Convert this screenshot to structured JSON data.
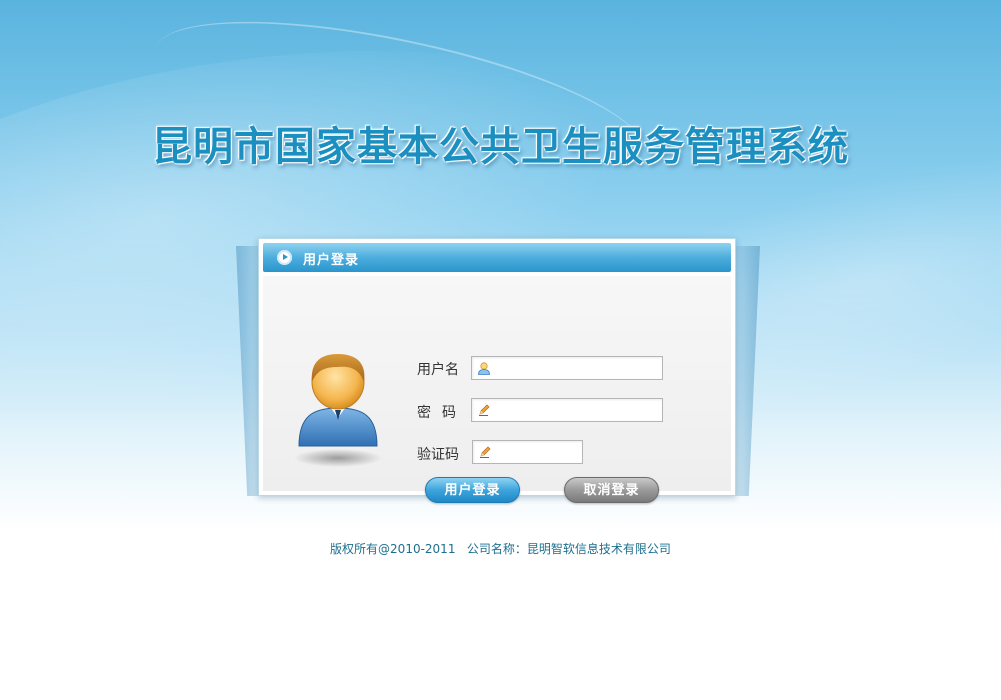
{
  "app": {
    "title": "昆明市国家基本公共卫生服务管理系统"
  },
  "login_panel": {
    "header_title": "用户登录",
    "username_label": "用户名",
    "password_label": "密码",
    "captcha_label": "验证码",
    "username_value": "",
    "password_value": "",
    "captcha_value": "",
    "login_button": "用户登录",
    "cancel_button": "取消登录"
  },
  "footer": {
    "copyright": "版权所有@2010-2011",
    "company": "公司名称：昆明智软信息技术有限公司"
  },
  "colors": {
    "title": "#1a8fc0",
    "header_bar": "#2a95cc",
    "login_button": "#3ea4dc",
    "cancel_button": "#9a9a9a",
    "footer_text": "#1d6f8f"
  },
  "icons": {
    "header": "play-circle-icon",
    "avatar": "user-avatar-icon",
    "username_field": "user-icon",
    "password_field": "pencil-icon",
    "captcha_field": "pencil-icon"
  }
}
